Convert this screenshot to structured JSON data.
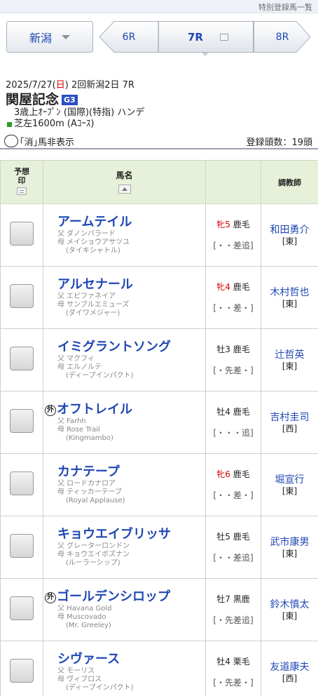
{
  "header": {
    "special_link": "特別登録馬一覧"
  },
  "nav": {
    "venue": "新潟",
    "prev_race": "6R",
    "current_race": "7R",
    "next_race": "8R"
  },
  "race": {
    "date_prefix": "2025/7/27(",
    "day": "日",
    "date_suffix": ") 2回新潟2日 7R",
    "name": "関屋記念",
    "grade": "G3",
    "conditions": "3歳上ｵｰﾌﾟﾝ (国際)(特指) ハンデ",
    "course": "芝左1600m (Aｺｰｽ)"
  },
  "filter": {
    "hide_scratched_label": "｢消｣馬非表示",
    "entry_count": "登録頭数：19頭"
  },
  "table": {
    "headers": {
      "prediction_line1": "予想",
      "prediction_line2": "印",
      "horse_name": "馬名",
      "trainer": "調教師"
    },
    "rows": [
      {
        "name": "アームテイル",
        "foreign": "",
        "sire": "父 ダノンバラード",
        "dam": "母 メイショウアサツユ",
        "bms": "(タイキシャトル)",
        "sex": "牝5",
        "coat": " 鹿毛",
        "sex_female": true,
        "legs": "[・・差追]",
        "trainer": "和田勇介",
        "belong": "[東]"
      },
      {
        "name": "アルセナール",
        "foreign": "",
        "sire": "父 エピファネイア",
        "dam": "母 サンブルエミューズ",
        "bms": "(ダイワメジャー)",
        "sex": "牝4",
        "coat": " 鹿毛",
        "sex_female": true,
        "legs": "[・・差・]",
        "trainer": "木村哲也",
        "belong": "[東]"
      },
      {
        "name": "イミグラントソング",
        "foreign": "",
        "sire": "父 マクフィ",
        "dam": "母 エルノルテ",
        "bms": "(ディープインパクト)",
        "sex": "牡3",
        "coat": " 鹿毛",
        "sex_female": false,
        "legs": "[・先差・]",
        "trainer": "辻哲英",
        "belong": "[東]"
      },
      {
        "name": "オフトレイル",
        "foreign": "外",
        "sire": "父 Farhh",
        "dam": "母 Rose Trail",
        "bms": "(Kingmambo)",
        "sex": "牡4",
        "coat": " 鹿毛",
        "sex_female": false,
        "legs": "[・・・追]",
        "trainer": "吉村圭司",
        "belong": "[西]"
      },
      {
        "name": "カナテープ",
        "foreign": "",
        "sire": "父 ロードカナロア",
        "dam": "母 ティッカーテープ",
        "bms": "(Royal Applause)",
        "sex": "牝6",
        "coat": " 鹿毛",
        "sex_female": true,
        "legs": "[・・差・]",
        "trainer": "堀宣行",
        "belong": "[東]"
      },
      {
        "name": "キョウエイブリッサ",
        "foreign": "",
        "sire": "父 グレーターロンドン",
        "dam": "母 キョウエイボズナン",
        "bms": "(ルーラーシップ)",
        "sex": "牡5",
        "coat": " 鹿毛",
        "sex_female": false,
        "legs": "[・・差追]",
        "trainer": "武市康男",
        "belong": "[東]"
      },
      {
        "name": "ゴールデンシロップ",
        "foreign": "外",
        "sire": "父 Havana Gold",
        "dam": "母 Muscovado",
        "bms": "(Mr. Greeley)",
        "sex": "牡7",
        "coat": " 黒鹿",
        "sex_female": false,
        "legs": "[・先差追]",
        "trainer": "鈴木慎太",
        "belong": "[東]"
      },
      {
        "name": "シヴァース",
        "foreign": "",
        "sire": "父 モーリス",
        "dam": "母 ヴィブロス",
        "bms": "(ディープインパクト)",
        "sex": "牡4",
        "coat": " 栗毛",
        "sex_female": false,
        "legs": "[・先差・]",
        "trainer": "友道康夫",
        "belong": "[西]"
      }
    ]
  }
}
